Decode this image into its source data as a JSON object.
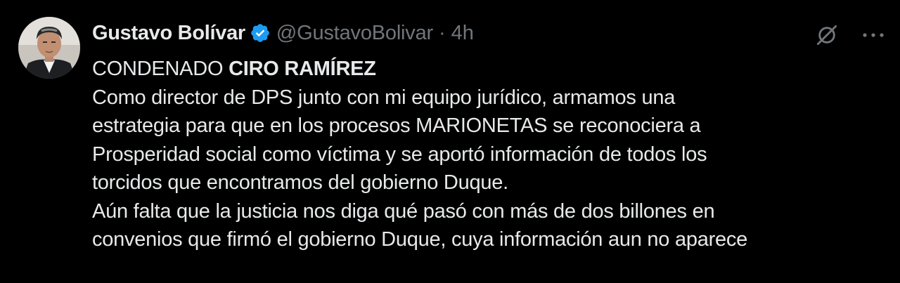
{
  "tweet": {
    "author_name": "Gustavo Bolívar",
    "handle": "@GustavoBolivar",
    "separator": "·",
    "time": "4h",
    "verified_icon": "verified-badge-icon",
    "accent_color": "#1d9bf0",
    "text": {
      "first_line_prefix": "CONDENADO ",
      "first_line_bold": "CIRO RAMÍREZ",
      "lines": [
        "Como director de DPS junto con mi equipo jurídico, armamos una",
        "estrategia para que en los procesos MARIONETAS se reconociera a",
        "Prosperidad social como víctima y se aportó información de todos los",
        "torcidos que encontramos del gobierno Duque.",
        "Aún falta que la justicia nos diga qué pasó con más de dos billones en",
        "convenios que firmó el gobierno Duque, cuya información aun no aparece"
      ]
    },
    "actions": {
      "grok_icon": "grok-icon",
      "more_icon": "more-icon"
    }
  }
}
